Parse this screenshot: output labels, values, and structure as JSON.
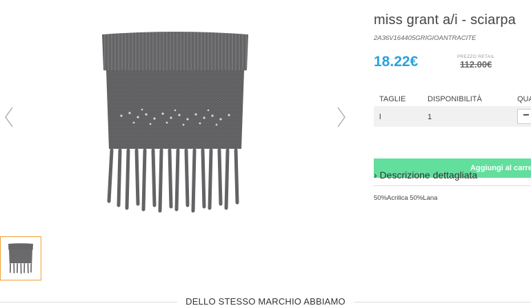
{
  "product": {
    "title": "miss grant a/i - sciarpa",
    "sku": "2A36V164405GRIGIOANTRACITE",
    "price": "18.22€",
    "retail_label": "PREZZO RETAIL",
    "retail_price": "112.00€"
  },
  "gallery": {
    "prev_icon": "chevron-left-icon",
    "next_icon": "chevron-right-icon"
  },
  "sizes": {
    "headers": [
      "TAGLIE",
      "DISPONIBILITÀ",
      "QUA"
    ],
    "rows": [
      {
        "size": "l",
        "availability": "1",
        "qty_button": "−"
      }
    ]
  },
  "actions": {
    "add_to_cart": "Aggiungi al carrell"
  },
  "description": {
    "toggle_label": "› Descrizione dettagliata",
    "text": "50%Acrilica 50%Lana"
  },
  "section": {
    "title": "DELLO STESSO MARCHIO ABBIAMO"
  },
  "colors": {
    "price": "#29a3dc",
    "cart_button": "#62df9d",
    "thumb_border": "#f0a030"
  }
}
